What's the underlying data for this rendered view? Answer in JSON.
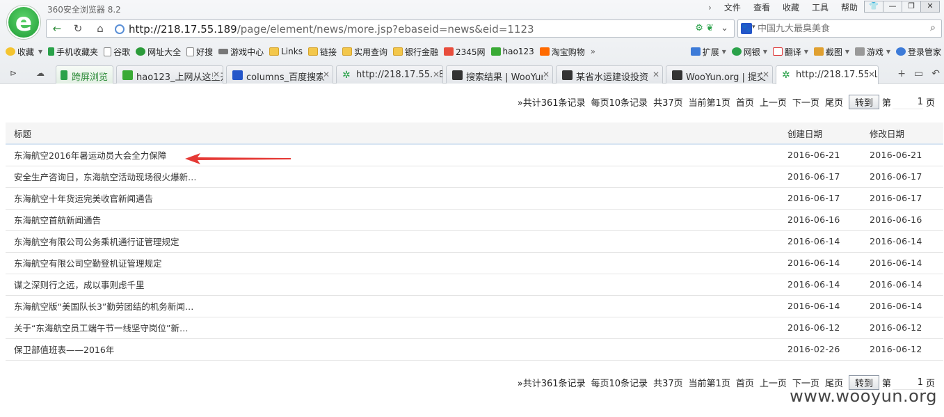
{
  "window": {
    "title": "360安全浏览器 8.2",
    "menu": [
      "文件",
      "查看",
      "收藏",
      "工具",
      "帮助"
    ]
  },
  "address": {
    "url_host": "http://218.17.55.189",
    "url_path": "/page/element/news/more.jsp?ebaseid=news&eid=1123"
  },
  "search": {
    "placeholder": "中国九大最臭美食"
  },
  "bookmarks": {
    "items": [
      "收藏",
      "手机收藏夹",
      "谷歌",
      "网址大全",
      "好搜",
      "游戏中心",
      "Links",
      "链接",
      "实用查询",
      "银行金融",
      "2345网",
      "hao123",
      "淘宝购物"
    ],
    "right": [
      "扩展",
      "网银",
      "翻译",
      "截图",
      "游戏",
      "登录管家"
    ]
  },
  "tabs": [
    {
      "label": "跨屏浏览"
    },
    {
      "label": "hao123_上网从这里开始"
    },
    {
      "label": "columns_百度搜索"
    },
    {
      "label": "http://218.17.55.189"
    },
    {
      "label": "搜索结果 | WooYun"
    },
    {
      "label": "某省水运建设投资"
    },
    {
      "label": "WooYun.org | 提交"
    },
    {
      "label": "http://218.17.55.189"
    }
  ],
  "pager": {
    "total": "»共计361条记录",
    "per_page": "每页10条记录",
    "pages": "共37页",
    "current": "当前第1页",
    "first": "首页",
    "prev": "上一页",
    "next": "下一页",
    "last": "尾页",
    "go": "转到",
    "di": "第",
    "page_value": "1",
    "ye": "页"
  },
  "table": {
    "headers": {
      "title": "标题",
      "created": "创建日期",
      "modified": "修改日期"
    },
    "rows": [
      {
        "title": "东海航空2016年暑运动员大会全力保障",
        "created": "2016-06-21",
        "modified": "2016-06-21"
      },
      {
        "title": "安全生产咨询日，东海航空活动现场很火爆新…",
        "created": "2016-06-17",
        "modified": "2016-06-17"
      },
      {
        "title": "东海航空十年货运完美收官新闻通告",
        "created": "2016-06-17",
        "modified": "2016-06-17"
      },
      {
        "title": "东海航空首航新闻通告",
        "created": "2016-06-16",
        "modified": "2016-06-16"
      },
      {
        "title": "东海航空有限公司公务乘机通行证管理规定",
        "created": "2016-06-14",
        "modified": "2016-06-14"
      },
      {
        "title": "东海航空有限公司空勤登机证管理规定",
        "created": "2016-06-14",
        "modified": "2016-06-14"
      },
      {
        "title": "谋之深则行之远，成以事则虑千里",
        "created": "2016-06-14",
        "modified": "2016-06-14"
      },
      {
        "title": "东海航空版“美国队长3”勤劳团结的机务新闻…",
        "created": "2016-06-14",
        "modified": "2016-06-14"
      },
      {
        "title": "关于“东海航空员工端午节一线坚守岗位”新…",
        "created": "2016-06-12",
        "modified": "2016-06-12"
      },
      {
        "title": "保卫部值班表——2016年",
        "created": "2016-02-26",
        "modified": "2016-06-12"
      }
    ]
  },
  "watermark": "www.wooyun.org",
  "colors": {
    "accent": "#2aa24a",
    "arrow": "#e53935"
  }
}
